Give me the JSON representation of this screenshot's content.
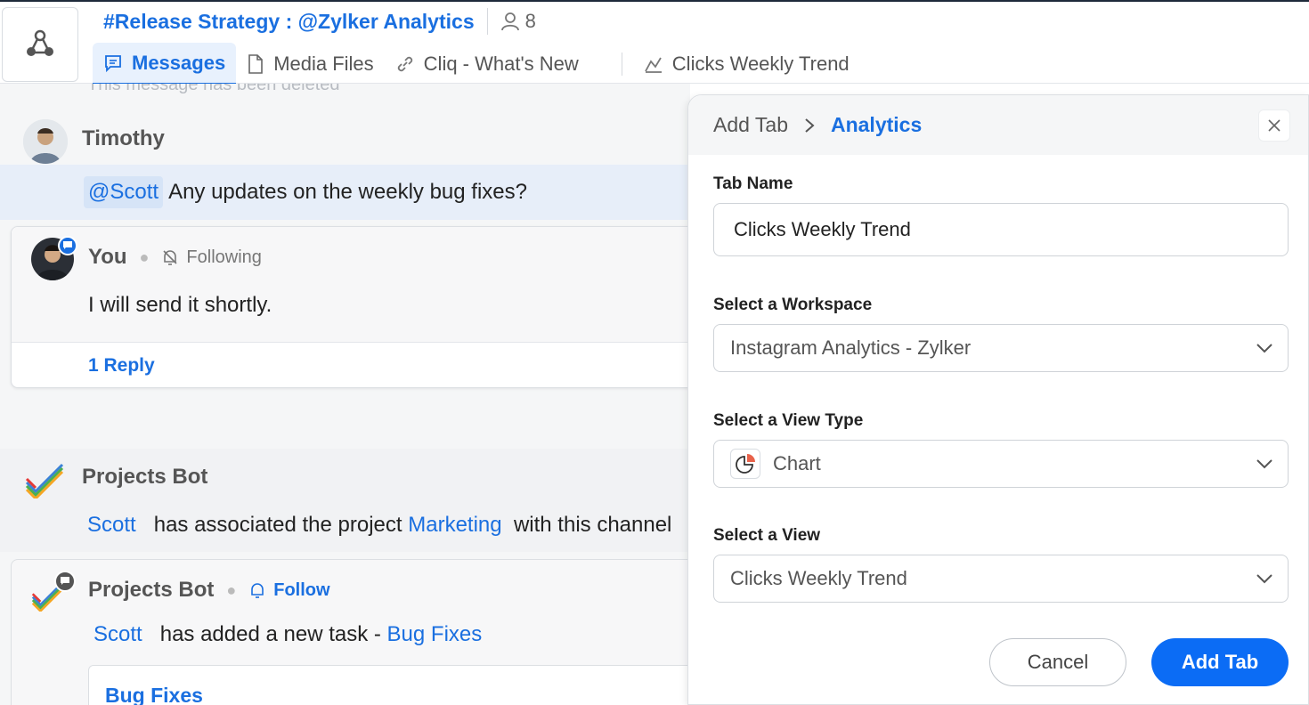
{
  "header": {
    "channel_title": "#Release Strategy : @Zylker Analytics",
    "member_count": "8",
    "tabs": [
      {
        "label": "Messages",
        "icon": "chat-icon"
      },
      {
        "label": "Media Files",
        "icon": "file-icon"
      },
      {
        "label": "Cliq - What's New",
        "icon": "link-icon"
      },
      {
        "label": "Clicks Weekly Trend",
        "icon": "chart-icon"
      }
    ]
  },
  "messages": {
    "deleted_text": "This message has been deleted",
    "timothy": {
      "name": "Timothy",
      "mention": "@Scott",
      "text": "Any updates on the weekly bug fixes?"
    },
    "you": {
      "name": "You",
      "follow_state": "Following",
      "text": "I will send it shortly.",
      "reply": "1 Reply"
    },
    "bot1": {
      "name": "Projects Bot",
      "user": "Scott",
      "text_a": "has associated the project",
      "project": "Marketing",
      "text_b": "with this channel"
    },
    "bot2": {
      "name": "Projects Bot",
      "follow_label": "Follow",
      "user": "Scott",
      "text": "has added a new task -",
      "task": "Bug Fixes",
      "card_title": "Bug Fixes"
    }
  },
  "panel": {
    "crumb_root": "Add Tab",
    "crumb_current": "Analytics",
    "tab_name_label": "Tab Name",
    "tab_name_value": "Clicks Weekly Trend",
    "workspace_label": "Select a Workspace",
    "workspace_value": "Instagram Analytics - Zylker",
    "view_type_label": "Select a View Type",
    "view_type_value": "Chart",
    "view_label": "Select a View",
    "view_value": "Clicks Weekly Trend",
    "cancel_label": "Cancel",
    "add_label": "Add Tab"
  },
  "colors": {
    "accent": "#1a6fe0",
    "primary_button": "#0b6cf5",
    "mention_bg": "#d6e4f7"
  }
}
